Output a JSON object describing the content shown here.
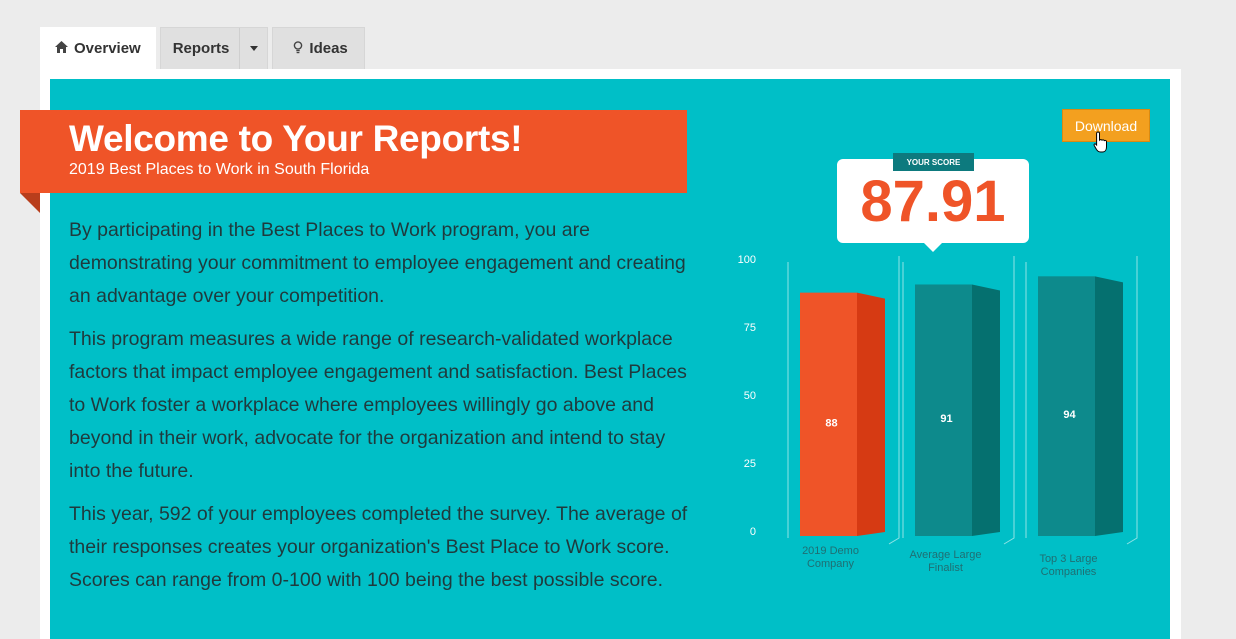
{
  "tabs": {
    "overview": {
      "label": "Overview",
      "icon": "home-icon"
    },
    "reports": {
      "label": "Reports",
      "icon": "chevron-down-icon"
    },
    "ideas": {
      "label": "Ideas",
      "icon": "lightbulb-icon"
    }
  },
  "banner": {
    "title": "Welcome to Your Reports!",
    "subtitle": "2019 Best Places to Work in South Florida"
  },
  "body": {
    "p1": "By participating in the Best Places to Work program, you are demonstrating your commitment to employee engagement and creating an advantage over your competition.",
    "p2": "This program measures a wide range of research-validated workplace factors that impact employee engagement and satisfaction. Best Places to Work foster a workplace where employees willingly go above and beyond in their work, advocate for the organization and intend to stay into the future.",
    "p3": "This year, 592 of your employees completed the survey. The average of their responses creates your organization's Best Place to Work score. Scores can range from 0-100 with 100 being the best possible score."
  },
  "download": {
    "label": "Download"
  },
  "score": {
    "ribbon": "YOUR SCORE",
    "value": "87.91"
  },
  "colors": {
    "panel": "#00bfc7",
    "accent_orange": "#ef5428",
    "teal_bar": "#0d8a8c",
    "download": "#f3a01f"
  },
  "chart_data": {
    "type": "bar",
    "categories": [
      "2019 Demo Company",
      "Average Large Finalist",
      "Top 3 Large Companies"
    ],
    "values": [
      88,
      91,
      94
    ],
    "data_labels": [
      "88",
      "91",
      "94"
    ],
    "ylim": [
      0,
      100
    ],
    "yticks": [
      "0",
      "25",
      "50",
      "75",
      "100"
    ],
    "bar_colors": [
      "#ef5428",
      "#0d8a8c",
      "#0d8a8c"
    ],
    "style": "3d"
  }
}
